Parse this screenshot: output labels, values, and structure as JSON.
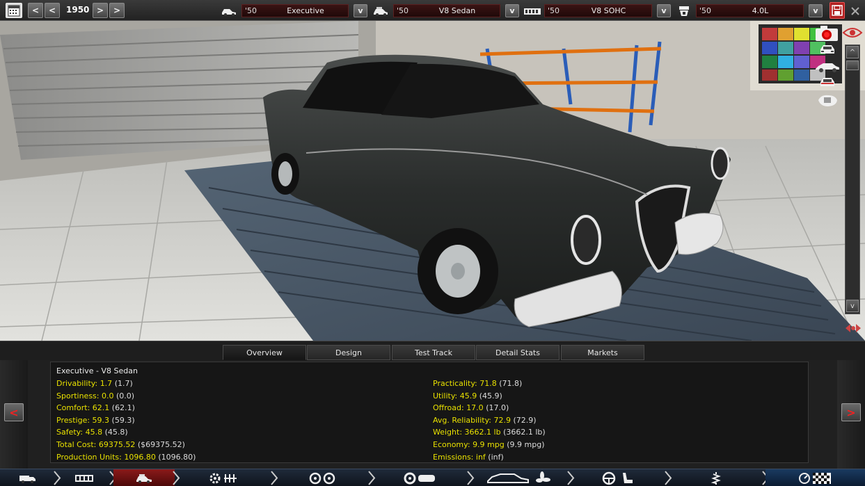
{
  "topbar": {
    "year": "1950",
    "prev_year_button": "<",
    "prev_year_button_2": "<",
    "next_year_button": ">",
    "next_year_button_2": ">",
    "fields": [
      {
        "year": "'50",
        "name": "Executive"
      },
      {
        "year": "'50",
        "name": "V8 Sedan"
      },
      {
        "year": "'50",
        "name": "V8 SOHC"
      },
      {
        "year": "'50",
        "name": "4.0L"
      }
    ],
    "dropdown_label": "v",
    "save_icon": "floppy-disk-icon"
  },
  "camera_views": [
    "camera-icon",
    "car-front-view-icon",
    "car-side-view-icon",
    "car-rear-view-icon",
    "car-top-view-icon"
  ],
  "scroll": {
    "up": "^",
    "down": "v"
  },
  "tabs": [
    {
      "label": "Overview",
      "active": true
    },
    {
      "label": "Design",
      "active": false
    },
    {
      "label": "Test Track",
      "active": false
    },
    {
      "label": "Detail Stats",
      "active": false
    },
    {
      "label": "Markets",
      "active": false
    }
  ],
  "stats": {
    "title": "Executive - V8 Sedan",
    "left": [
      {
        "label": "Drivability:",
        "value": "1.7",
        "prev": "(1.7)"
      },
      {
        "label": "Sportiness:",
        "value": "0.0",
        "prev": "(0.0)"
      },
      {
        "label": "Comfort:",
        "value": "62.1",
        "prev": "(62.1)"
      },
      {
        "label": "Prestige:",
        "value": "59.3",
        "prev": "(59.3)"
      },
      {
        "label": "Safety:",
        "value": "45.8",
        "prev": "(45.8)"
      },
      {
        "label": "Total Cost:",
        "value": "69375.52",
        "prev": "($69375.52)"
      },
      {
        "label": "Production Units:",
        "value": "1096.80",
        "prev": "(1096.80)"
      }
    ],
    "right": [
      {
        "label": "Practicality:",
        "value": "71.8",
        "prev": "(71.8)"
      },
      {
        "label": "Utility:",
        "value": "45.9",
        "prev": "(45.9)"
      },
      {
        "label": "Offroad:",
        "value": "17.0",
        "prev": "(17.0)"
      },
      {
        "label": "Avg. Reliability:",
        "value": "72.9",
        "prev": "(72.9)"
      },
      {
        "label": "Weight:",
        "value": "3662.1 lb",
        "prev": "(3662.1 lb)"
      },
      {
        "label": "Economy:",
        "value": "9.9 mpg",
        "prev": "(9.9 mpg)"
      },
      {
        "label": "Emissions:",
        "value": "inf",
        "prev": "(inf)"
      }
    ]
  },
  "panel_nav": {
    "prev": "<",
    "next": ">"
  },
  "bottom_nav": [
    {
      "icon": "truck-icon",
      "active": false
    },
    {
      "icon": "chassis-icon",
      "active": false
    },
    {
      "icon": "car-body-icon",
      "active": true
    },
    {
      "icon": "engine-gear-icon",
      "active": false
    },
    {
      "icon": "wheels-icon",
      "active": false
    },
    {
      "icon": "brakes-icon",
      "active": false
    },
    {
      "icon": "car-fan-icon",
      "active": false
    },
    {
      "icon": "steering-seat-icon",
      "active": false
    },
    {
      "icon": "suspension-icon",
      "active": false
    },
    {
      "icon": "finish-flag-icon",
      "active": false
    }
  ],
  "colors": {
    "accent": "#e8e000",
    "save": "#b02020",
    "active_nav": "#7a1010"
  }
}
